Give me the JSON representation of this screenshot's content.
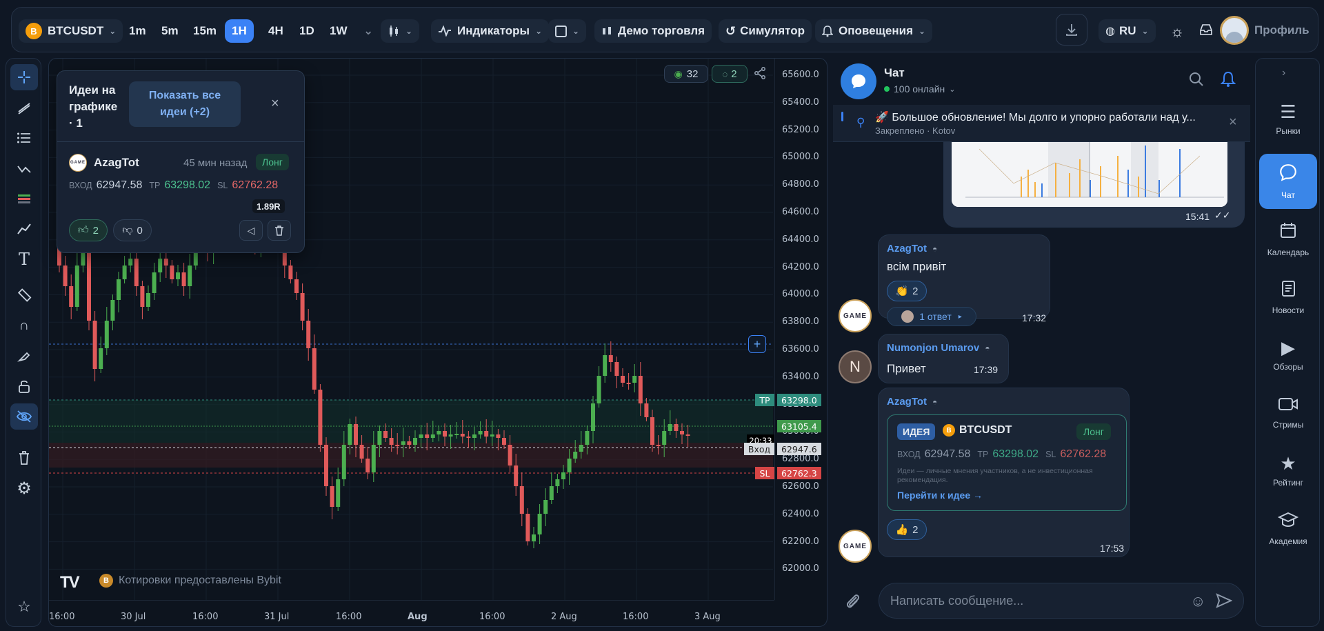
{
  "topbar": {
    "symbol": "BTCUSDT",
    "coin_letter": "B",
    "intervals": [
      "1m",
      "5m",
      "15m",
      "1H",
      "4H",
      "1D",
      "1W"
    ],
    "active_interval": "1H",
    "indicators": "Индикаторы",
    "demo": "Демо торговля",
    "simulator": "Симулятор",
    "alerts": "Оповещения",
    "language": "RU",
    "profile": "Профиль"
  },
  "chart": {
    "watchers": "32",
    "ideas_count": "2",
    "price_labels": [
      "65600.0",
      "65400.0",
      "65200.0",
      "65000.0",
      "64800.0",
      "64600.0",
      "64400.0",
      "64200.0",
      "64000.0",
      "63800.0",
      "63600.0",
      "63400.0",
      "63200.0",
      "63000.0",
      "62800.0",
      "62600.0",
      "62400.0",
      "62200.0",
      "62000.0"
    ],
    "time_labels": [
      "16:00",
      "30 Jul",
      "16:00",
      "31 Jul",
      "16:00",
      "Aug",
      "16:00",
      "2 Aug",
      "16:00",
      "3 Aug"
    ],
    "tp_tag": "TP",
    "tp_price": "63298.0",
    "current_price": "63105.4",
    "entry_time": "20:33",
    "entry_tag": "Вход",
    "entry_price": "62947.6",
    "sl_tag": "SL",
    "sl_price": "62762.3",
    "attribution_coin": "B",
    "attribution": "Котировки предоставлены Bybit",
    "logo": "TV"
  },
  "ideas_panel": {
    "title": "Идеи на графике · 1",
    "show_all": "Показать все идеи (+2)",
    "author": "AzagTot",
    "time_ago": "45 мин назад",
    "direction": "Лонг",
    "entry_label": "ВХОД",
    "entry_value": "62947.58",
    "tp_label": "TP",
    "tp_value": "63298.02",
    "sl_label": "SL",
    "sl_value": "62762.28",
    "rr": "1.89R",
    "likes": "2",
    "dislikes": "0"
  },
  "chat": {
    "title": "Чат",
    "online": "100 онлайн",
    "pinned_text": "🚀 Большое обновление! Мы долго и упорно работали над у...",
    "pinned_meta": "Закреплено · Kotov",
    "image_msg_time": "15:41",
    "msg1": {
      "author": "AzagTot",
      "text": "всім привіт",
      "reaction_emoji": "👏",
      "reaction_count": "2",
      "replies": "1 ответ",
      "time": "17:32"
    },
    "msg2": {
      "avatar_letter": "N",
      "author": "Numonjon Umarov",
      "text": "Привет",
      "time": "17:39"
    },
    "msg3": {
      "author": "AzagTot",
      "idea_badge": "ИДЕЯ",
      "coin_letter": "B",
      "symbol": "BTCUSDT",
      "direction": "Лонг",
      "entry_label": "ВХОД",
      "entry_value": "62947.58",
      "tp_label": "TP",
      "tp_value": "63298.02",
      "sl_label": "SL",
      "sl_value": "62762.28",
      "disclaimer": "Идеи — личные мнения участников, а не инвестиционная рекомендация.",
      "link": "Перейти к идее →",
      "reaction_emoji": "👍",
      "reaction_count": "2",
      "time": "17:53"
    },
    "avatar_game_text": "GAME",
    "input_placeholder": "Написать сообщение..."
  },
  "rightnav": [
    {
      "label": "Рынки",
      "icon": "markets-icon"
    },
    {
      "label": "Чат",
      "icon": "chat-icon"
    },
    {
      "label": "Календарь",
      "icon": "calendar-icon"
    },
    {
      "label": "Новости",
      "icon": "news-icon"
    },
    {
      "label": "Обзоры",
      "icon": "play-icon"
    },
    {
      "label": "Стримы",
      "icon": "video-icon"
    },
    {
      "label": "Рейтинг",
      "icon": "star-icon"
    },
    {
      "label": "Академия",
      "icon": "academy-icon"
    }
  ],
  "colors": {
    "accent": "#3b82f6",
    "up": "#4caf50",
    "down": "#e05a5a",
    "tp": "#2e8c7d",
    "sl": "#d64545"
  }
}
